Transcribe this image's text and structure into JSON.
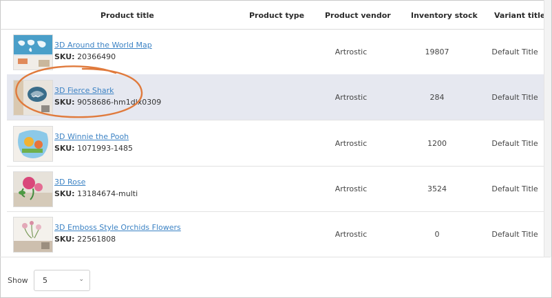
{
  "table": {
    "columns": [
      "Product title",
      "Product type",
      "Product vendor",
      "Inventory stock",
      "Variant title"
    ],
    "sku_label": "SKU:",
    "rows": [
      {
        "title": "3D Around the World Map",
        "sku": "20366490",
        "type": "",
        "vendor": "Artrostic",
        "stock": "19807",
        "variant": "Default Title",
        "thumbnail": "world-map-wall-decal"
      },
      {
        "title": "3D Fierce Shark",
        "sku": "9058686-hm1dlx0309",
        "type": "",
        "vendor": "Artrostic",
        "stock": "284",
        "variant": "Default Title",
        "thumbnail": "shark-wall-decal"
      },
      {
        "title": "3D Winnie the Pooh",
        "sku": "1071993-1485",
        "type": "",
        "vendor": "Artrostic",
        "stock": "1200",
        "variant": "Default Title",
        "thumbnail": "winnie-pooh-wall-decal"
      },
      {
        "title": "3D Rose",
        "sku": "13184674-multi",
        "type": "",
        "vendor": "Artrostic",
        "stock": "3524",
        "variant": "Default Title",
        "thumbnail": "rose-wall-decal"
      },
      {
        "title": "3D Emboss Style Orchids Flowers",
        "sku": "22561808",
        "type": "",
        "vendor": "Artrostic",
        "stock": "0",
        "variant": "Default Title",
        "thumbnail": "orchid-wall-decal"
      }
    ]
  },
  "footer": {
    "show_label": "Show",
    "page_size": "5"
  },
  "colors": {
    "link": "#3b82c4",
    "highlight_row": "#e6e8f0",
    "annotation": "#e07a3c"
  }
}
